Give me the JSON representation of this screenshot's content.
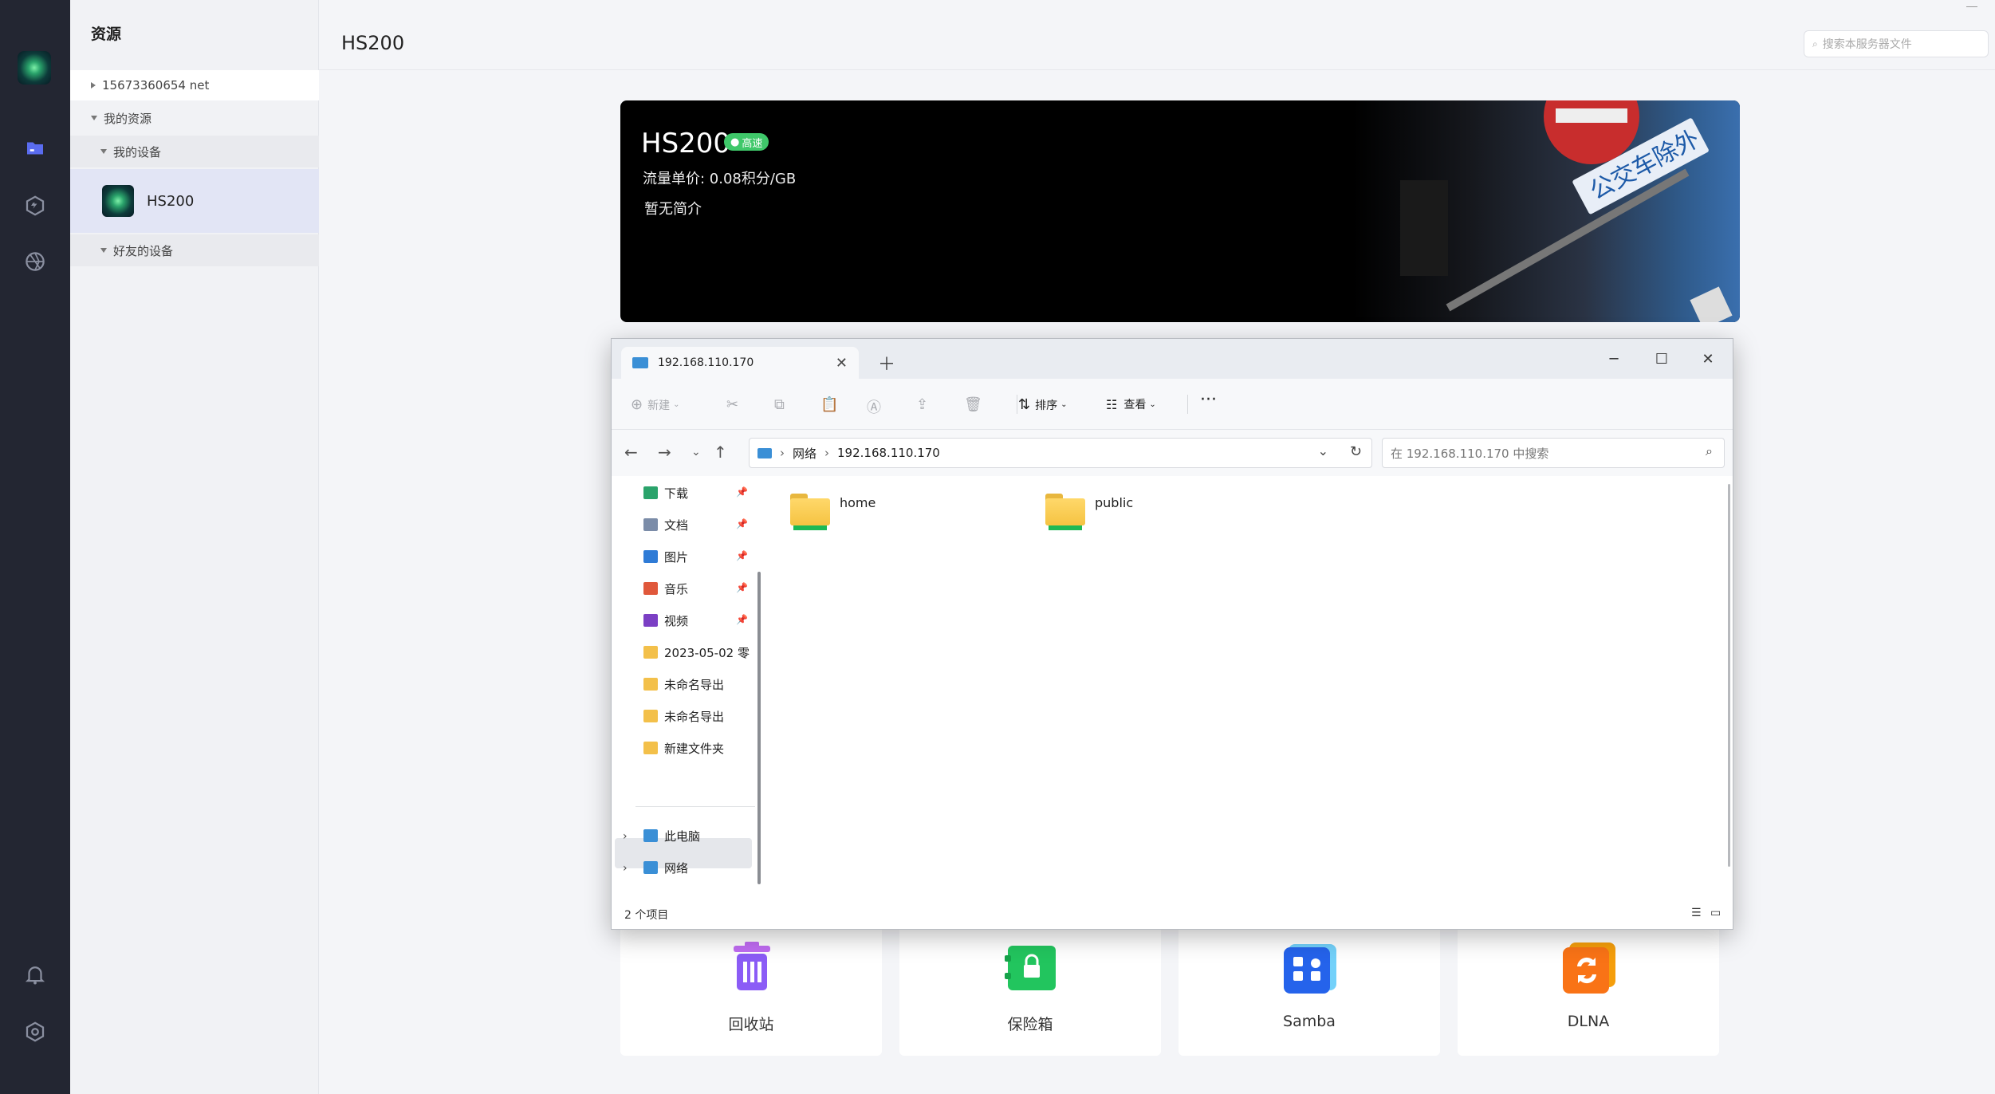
{
  "app": {
    "sidebar_title": "资源",
    "page_title": "HS200",
    "search_placeholder": "搜索本服务器文件"
  },
  "tree": {
    "account": "15673360654 net",
    "my_resources": "我的资源",
    "my_devices": "我的设备",
    "device": "HS200",
    "friend_devices": "好友的设备"
  },
  "banner": {
    "name": "HS200",
    "badge": "高速",
    "price": "流量单价: 0.08积分/GB",
    "description": "暂无简介"
  },
  "cards": [
    {
      "label": "回收站",
      "color": "#8b5cf6"
    },
    {
      "label": "保险箱",
      "color": "#22c55e"
    },
    {
      "label": "Samba",
      "color": "#2563eb"
    },
    {
      "label": "DLNA",
      "color": "#f97316"
    }
  ],
  "explorer": {
    "tab_title": "192.168.110.170",
    "toolbar": {
      "new": "新建",
      "sort": "排序",
      "view": "查看"
    },
    "breadcrumb": [
      "网络",
      "192.168.110.170"
    ],
    "search_placeholder": "在 192.168.110.170 中搜索",
    "nav_items": [
      {
        "label": "下载",
        "color": "#2aa36b"
      },
      {
        "label": "文档",
        "color": "#7b8ca8"
      },
      {
        "label": "图片",
        "color": "#2f7bd6"
      },
      {
        "label": "音乐",
        "color": "#e0583b"
      },
      {
        "label": "视频",
        "color": "#7b3fc4"
      },
      {
        "label": "2023-05-02 零",
        "color": "#f3c04a"
      },
      {
        "label": "未命名导出",
        "color": "#f3c04a"
      },
      {
        "label": "未命名导出",
        "color": "#f3c04a"
      },
      {
        "label": "新建文件夹",
        "color": "#f3c04a"
      }
    ],
    "nav_roots": [
      {
        "label": "此电脑",
        "color": "#3a8fd6"
      },
      {
        "label": "网络",
        "color": "#3a8fd6"
      }
    ],
    "folders": [
      "home",
      "public"
    ],
    "status": "2 个项目"
  }
}
